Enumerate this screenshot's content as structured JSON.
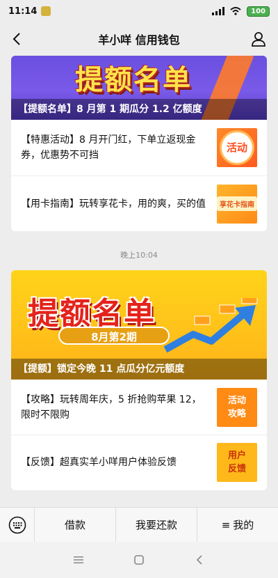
{
  "status_bar": {
    "time": "11:14",
    "battery": "100"
  },
  "nav": {
    "title": "羊小咩 信用钱包"
  },
  "card1": {
    "banner_title": "提额名单",
    "banner_caption": "【提额名单】8 月第 1 期瓜分 1.2 亿额度",
    "items": [
      {
        "text": "【特惠活动】8 月开门红，下单立返现金券，优惠势不可挡",
        "thumb_label": "活动"
      },
      {
        "text": "【用卡指南】玩转享花卡，用的爽，买的值",
        "thumb_label": "享花卡指南"
      }
    ]
  },
  "timestamp": "晚上10:04",
  "card2": {
    "banner_title": "提额名单",
    "banner_pill": "8月第2期",
    "banner_caption": "【提额】锁定今晚 11 点瓜分亿元额度",
    "items": [
      {
        "text": "【攻略】玩转周年庆，5 折抢购苹果 12，限时不限购",
        "thumb_lines": [
          "活动",
          "攻略"
        ]
      },
      {
        "text": "【反馈】超真实羊小咩用户体验反馈",
        "thumb_lines": [
          "用户",
          "反馈"
        ]
      }
    ]
  },
  "bottom_menu": {
    "items": [
      {
        "label": "借款"
      },
      {
        "label": "我要还款"
      },
      {
        "label": "我的",
        "prefix": "≡"
      }
    ]
  },
  "colors": {
    "banner1": "#6a4fe0",
    "banner2": "#ffc21a",
    "accent_orange": "#ff8a14",
    "title_red": "#e4231b"
  },
  "icons": {
    "back": "chevron-left-icon",
    "user": "user-icon",
    "keyboard": "keyboard-icon",
    "sys_menu": "menu-icon",
    "sys_home": "home-square-icon",
    "sys_back": "back-triangle-icon"
  }
}
